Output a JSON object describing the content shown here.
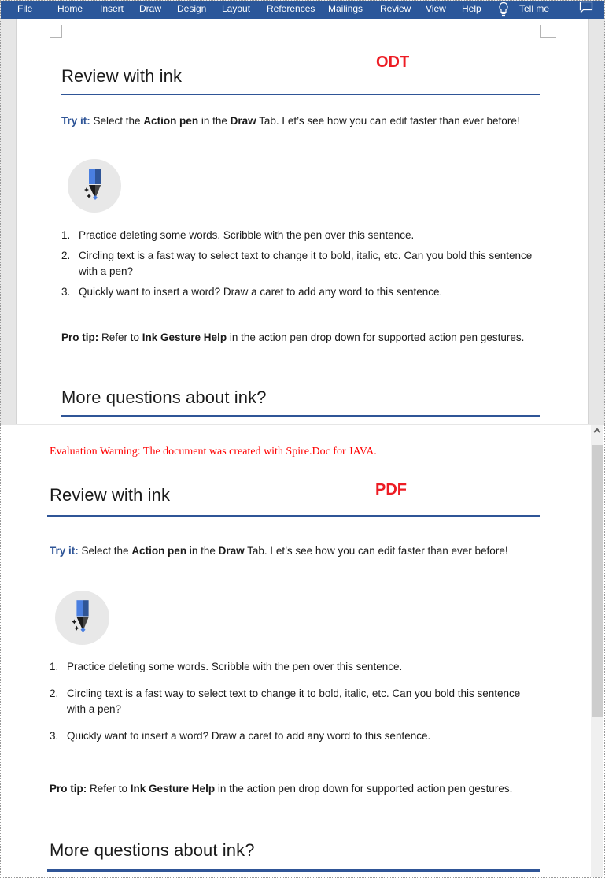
{
  "ribbon": {
    "tabs": [
      "File",
      "Home",
      "Insert",
      "Draw",
      "Design",
      "Layout",
      "References",
      "Mailings",
      "Review",
      "View",
      "Help"
    ],
    "tell_me": "Tell me"
  },
  "odt": {
    "label": "ODT",
    "heading1": "Review with ink",
    "try_it_label": "Try it:",
    "try_it_t1": " Select the ",
    "try_it_b1": "Action pen",
    "try_it_t2": " in the ",
    "try_it_b2": "Draw",
    "try_it_t3": " Tab. Let’s see how you can edit faster than ever before!",
    "steps": [
      {
        "num": "1.",
        "text": "Practice deleting some words. Scribble with the pen over this sentence."
      },
      {
        "num": "2.",
        "text": "Circling text is a fast way to select text to change it to bold, italic, etc. Can you bold this sentence with a pen?"
      },
      {
        "num": "3.",
        "text": "Quickly want to insert a word? Draw a caret to add any word to this sentence."
      }
    ],
    "pro_tip_label": "Pro tip:",
    "pro_tip_t1": " Refer to ",
    "pro_tip_b1": "Ink Gesture Help",
    "pro_tip_t2": " in the action pen drop down for supported action pen gestures.",
    "heading2": "More questions about ink?"
  },
  "pdf": {
    "label": "PDF",
    "eval_warning": "Evaluation Warning: The document was created with Spire.Doc for JAVA.",
    "heading1": "Review with ink",
    "try_it_label": "Try it:",
    "try_it_t1": " Select the ",
    "try_it_b1": "Action pen",
    "try_it_t2": " in the ",
    "try_it_b2": "Draw",
    "try_it_t3": " Tab. Let’s see how you can edit faster than ever before!",
    "steps": [
      {
        "num": "1.",
        "text": "Practice deleting some words. Scribble with the pen over this sentence."
      },
      {
        "num": "2.",
        "text": "Circling text is a fast way to select text to change it to bold, italic, etc. Can you bold this sentence with a pen?"
      },
      {
        "num": "3.",
        "text": "Quickly want to insert a word? Draw a caret to add any word to this sentence."
      }
    ],
    "pro_tip_label": "Pro tip:",
    "pro_tip_t1": " Refer to ",
    "pro_tip_b1": "Ink Gesture Help",
    "pro_tip_t2": " in the action pen drop down for supported action pen gestures.",
    "heading2": "More questions about ink?"
  },
  "colors": {
    "ribbon": "#2b579a",
    "heading_rule": "#2f5597",
    "label_red": "#ed1c24",
    "eval_warning": "#ff0000"
  }
}
